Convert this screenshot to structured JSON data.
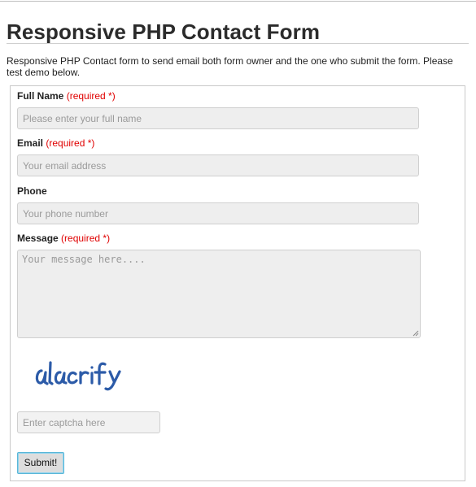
{
  "page": {
    "title": "Responsive PHP Contact Form",
    "intro": "Responsive PHP Contact form to send email both form owner and the one who submit the form. Please test demo below."
  },
  "form": {
    "full_name": {
      "label": "Full Name",
      "required": "(required *)",
      "placeholder": "Please enter your full name"
    },
    "email": {
      "label": "Email",
      "required": "(required *)",
      "placeholder": "Your email address"
    },
    "phone": {
      "label": "Phone",
      "placeholder": "Your phone number"
    },
    "message": {
      "label": "Message",
      "required": "(required *)",
      "placeholder": "Your message here...."
    },
    "captcha": {
      "image_text": "alacrify",
      "placeholder": "Enter captcha here"
    },
    "submit_label": "Submit!"
  },
  "colors": {
    "required": "#e00000",
    "input_bg": "#eeeeee",
    "submit_focus_border": "#5ab7d8"
  }
}
